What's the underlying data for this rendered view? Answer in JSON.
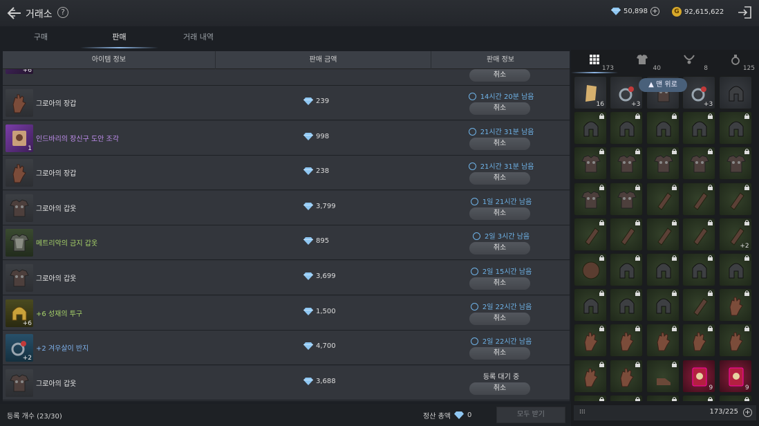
{
  "header": {
    "title": "거래소",
    "help_label": "?",
    "diamonds": "50,898",
    "gold_label": "G",
    "gold": "92,615,622",
    "plus_label": "+"
  },
  "tabs": [
    {
      "label": "구매",
      "active": false
    },
    {
      "label": "판매",
      "active": true
    },
    {
      "label": "거래 내역",
      "active": false
    }
  ],
  "table": {
    "col_item": "아이템 정보",
    "col_price": "판매 금액",
    "col_info": "판매 정보",
    "partial_top": {
      "enhance": "+6",
      "cancel": "취소"
    },
    "rows": [
      {
        "name": "그로아의 장갑",
        "grade": "white",
        "price": "239",
        "status": "14시간 20분 남음",
        "cancel": "취소",
        "count": "",
        "icon": "glove"
      },
      {
        "name": "인드바리의 장신구 도안 조각",
        "grade": "purple",
        "price": "998",
        "status": "21시간 31분 남음",
        "cancel": "취소",
        "count": "1",
        "icon": "scroll"
      },
      {
        "name": "그로아의 장갑",
        "grade": "white",
        "price": "238",
        "status": "21시간 31분 남음",
        "cancel": "취소",
        "count": "",
        "icon": "glove"
      },
      {
        "name": "그로아의 갑옷",
        "grade": "white",
        "price": "3,799",
        "status": "1일 21시간 남음",
        "cancel": "취소",
        "count": "",
        "icon": "armor"
      },
      {
        "name": "메트리악의 금지 갑옷",
        "grade": "green",
        "price": "895",
        "status": "2일 3시간 남음",
        "cancel": "취소",
        "count": "",
        "icon": "armor-green"
      },
      {
        "name": "그로아의 갑옷",
        "grade": "white",
        "price": "3,699",
        "status": "2일 15시간 남음",
        "cancel": "취소",
        "count": "",
        "icon": "armor"
      },
      {
        "name": "+6 성재의 투구",
        "grade": "green",
        "price": "1,500",
        "status": "2일 22시간 남음",
        "cancel": "취소",
        "count": "+6",
        "icon": "helmet"
      },
      {
        "name": "+2 겨우살이 반지",
        "grade": "blue",
        "price": "4,700",
        "status": "2일 22시간 남음",
        "cancel": "취소",
        "count": "+2",
        "icon": "ring"
      },
      {
        "name": "그로아의 갑옷",
        "grade": "white",
        "price": "3,688",
        "status": "등록 대기 중",
        "cancel": "취소",
        "count": "",
        "icon": "armor",
        "pending": true
      }
    ]
  },
  "footer": {
    "count_label": "등록 개수 (23/30)",
    "total_label": "정산 총액",
    "total_value": "0",
    "claim_label": "모두 받기"
  },
  "inventory": {
    "tabs": [
      {
        "count": "173",
        "icon": "grid-icon",
        "active": true
      },
      {
        "count": "40",
        "icon": "armor-icon",
        "active": false
      },
      {
        "count": "8",
        "icon": "necklace-icon",
        "active": false
      },
      {
        "count": "125",
        "icon": "potion-icon",
        "active": false
      }
    ],
    "to_top_label": "▲ 맨 위로",
    "capacity": "173/225",
    "first_row_counts": [
      "16",
      "+3",
      "",
      "+3",
      ""
    ],
    "row5_last_count": "+2",
    "last_row_counts": [
      "",
      "",
      "",
      "9",
      "9"
    ]
  },
  "colors": {
    "accent_blue": "#6fb3e8",
    "grade_purple": "#c28ff0",
    "grade_green": "#a8d46a",
    "grade_blue": "#7fb4f0"
  }
}
